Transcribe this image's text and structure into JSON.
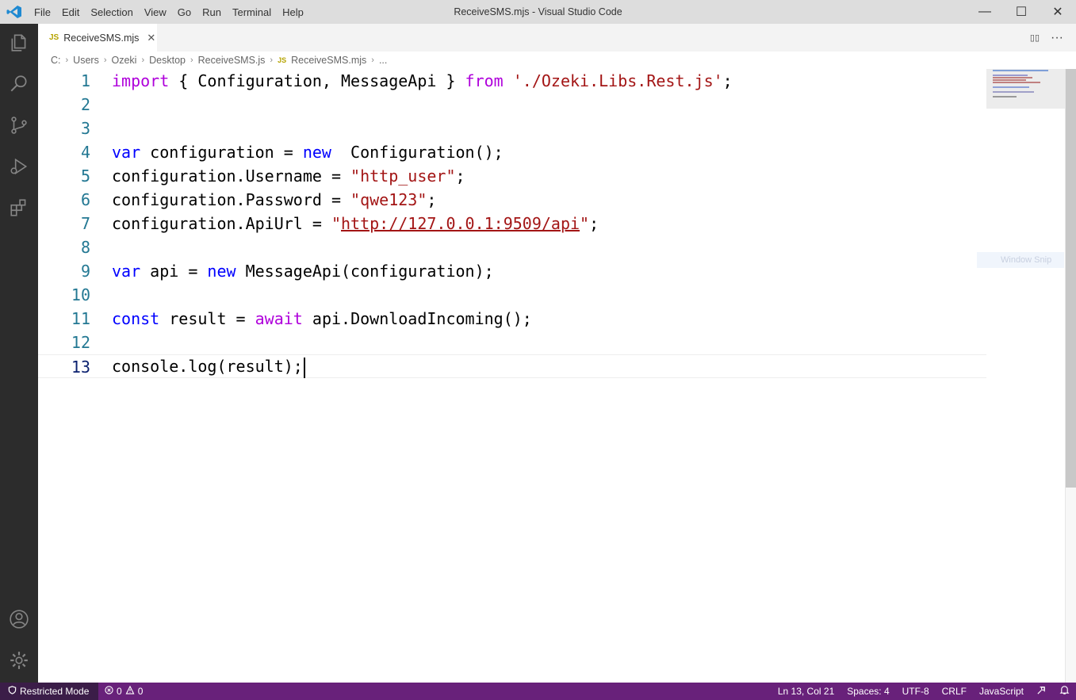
{
  "window": {
    "title": "ReceiveSMS.mjs - Visual Studio Code"
  },
  "menu": [
    "File",
    "Edit",
    "Selection",
    "View",
    "Go",
    "Run",
    "Terminal",
    "Help"
  ],
  "window_controls": {
    "minimize": "—",
    "maximize": "☐",
    "close": "✕"
  },
  "activity_bar": [
    "explorer-icon",
    "search-icon",
    "source-control-icon",
    "run-debug-icon",
    "extensions-icon",
    "accounts-icon",
    "manage-gear-icon"
  ],
  "tab": {
    "icon": "JS",
    "label": "ReceiveSMS.mjs",
    "close": "✕"
  },
  "tab_actions": {
    "split": "▯▯",
    "more": "···"
  },
  "breadcrumb": {
    "items": [
      "C:",
      "Users",
      "Ozeki",
      "Desktop",
      "ReceiveSMS.js"
    ],
    "file_icon": "JS",
    "file": "ReceiveSMS.mjs",
    "ellipsis": "..."
  },
  "editor": {
    "line_numbers": [
      "1",
      "2",
      "3",
      "4",
      "5",
      "6",
      "7",
      "8",
      "9",
      "10",
      "11",
      "12",
      "13"
    ],
    "cursor_line": 13,
    "tokens": {
      "l1_import": "import",
      "l1_braces": " { Configuration, MessageApi } ",
      "l1_from": "from",
      "l1_sp": " ",
      "l1_path": "'./Ozeki.Libs.Rest.js'",
      "l1_end": ";",
      "l4_var": "var",
      "l4_mid": " configuration = ",
      "l4_new": "new",
      "l4_end": "  Configuration();",
      "l5_start": "configuration.Username = ",
      "l5_str": "\"http_user\"",
      "l5_end": ";",
      "l6_start": "configuration.Password = ",
      "l6_str": "\"qwe123\"",
      "l6_end": ";",
      "l7_start": "configuration.ApiUrl = ",
      "l7_q1": "\"",
      "l7_url": "http://127.0.0.1:9509/api",
      "l7_q2": "\"",
      "l7_end": ";",
      "l9_var": "var",
      "l9_mid": " api = ",
      "l9_new": "new",
      "l9_end": " MessageApi(configuration);",
      "l11_const": "const",
      "l11_mid": " result = ",
      "l11_await": "await",
      "l11_end": " api.DownloadIncoming();",
      "l13": "console.log(result);"
    }
  },
  "overlay": {
    "label": "Window Snip"
  },
  "status_bar": {
    "restricted": "Restricted Mode",
    "errors": "0",
    "warnings": "0",
    "position": "Ln 13, Col 21",
    "spaces": "Spaces: 4",
    "encoding": "UTF-8",
    "eol": "CRLF",
    "language": "JavaScript"
  },
  "colors": {
    "titlebar": "#dddddd",
    "activity_bar": "#2c2c2c",
    "status_bar": "#68217a",
    "keyword": "#0000ff",
    "control_keyword": "#af00db",
    "string": "#a31515",
    "line_number": "#237893"
  }
}
